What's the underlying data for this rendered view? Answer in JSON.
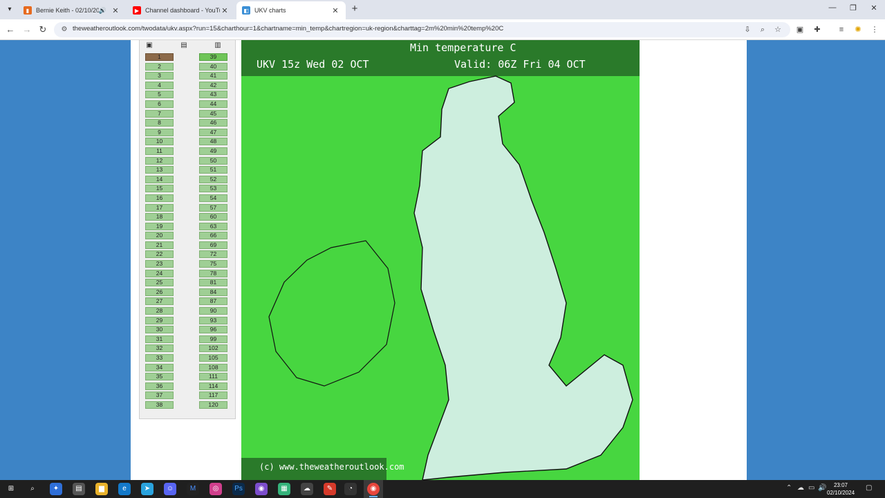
{
  "browser": {
    "tabs": [
      {
        "title": "Bernie Keith - 02/10/2024 -",
        "icon": "audio-wave-icon",
        "active": false,
        "audio": true
      },
      {
        "title": "Channel dashboard - YouTube Studio",
        "icon": "youtube-icon",
        "active": false,
        "audio": false
      },
      {
        "title": "UKV charts",
        "icon": "weather-outlook-icon",
        "active": true,
        "audio": false
      }
    ],
    "url": "theweatheroutlook.com/twodata/ukv.aspx?run=15&charthour=1&chartname=min_temp&chartregion=uk-region&charttag=2m%20min%20temp%20C"
  },
  "sidebar": {
    "col_a": [
      "1",
      "2",
      "3",
      "4",
      "5",
      "6",
      "7",
      "8",
      "9",
      "10",
      "11",
      "12",
      "13",
      "14",
      "15",
      "16",
      "17",
      "18",
      "19",
      "20",
      "21",
      "22",
      "23",
      "24",
      "25",
      "26",
      "27",
      "28",
      "29",
      "30",
      "31",
      "32",
      "33",
      "34",
      "35",
      "36",
      "37",
      "38"
    ],
    "col_b": [
      "39",
      "40",
      "41",
      "42",
      "43",
      "44",
      "45",
      "46",
      "47",
      "48",
      "49",
      "50",
      "51",
      "52",
      "53",
      "54",
      "57",
      "60",
      "63",
      "66",
      "69",
      "72",
      "75",
      "78",
      "81",
      "84",
      "87",
      "90",
      "93",
      "96",
      "99",
      "102",
      "105",
      "108",
      "111",
      "114",
      "117",
      "120"
    ],
    "selected_a": "1",
    "selected_b": "39"
  },
  "chart": {
    "title": "Min temperature C",
    "run": "UKV 15z Wed 02 OCT",
    "valid": "Valid: 06Z Fri 04 OCT",
    "copyright": "(c) www.theweatheroutlook.com",
    "colors": {
      "sea": "#47d640",
      "land": "#cdeede",
      "header": "#2a7a2a",
      "text": "#111111"
    }
  },
  "taskbar": {
    "time": "23:07",
    "date": "02/10/2024"
  }
}
